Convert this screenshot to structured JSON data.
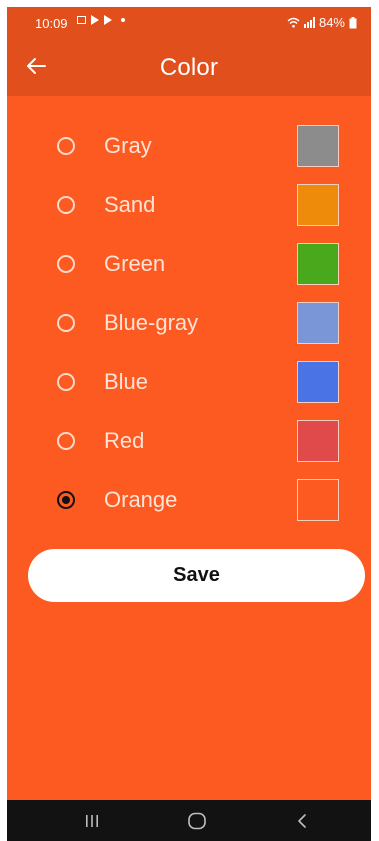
{
  "status_bar": {
    "time": "10:09",
    "battery": "84%",
    "icons": [
      "image-icon",
      "play-store-icon",
      "play-store-icon",
      "dot-icon",
      "wifi-icon",
      "signal-icon",
      "battery-icon"
    ]
  },
  "app_bar": {
    "title": "Color",
    "back_icon": "arrow-left-icon"
  },
  "options": [
    {
      "label": "Gray",
      "color": "#8c8c8c",
      "selected": false
    },
    {
      "label": "Sand",
      "color": "#ee8b0b",
      "selected": false
    },
    {
      "label": "Green",
      "color": "#4aa81d",
      "selected": false
    },
    {
      "label": "Blue-gray",
      "color": "#7a96d6",
      "selected": false
    },
    {
      "label": "Blue",
      "color": "#4a74e6",
      "selected": false
    },
    {
      "label": "Red",
      "color": "#e04a4a",
      "selected": false
    },
    {
      "label": "Orange",
      "color": "#fd5a22",
      "selected": true
    }
  ],
  "save_label": "Save",
  "nav_bar": {
    "icons": [
      "recent-apps-icon",
      "home-icon",
      "back-icon"
    ]
  },
  "colors": {
    "accent": "#fd5a22",
    "app_bar": "#e04f1c",
    "nav_bar": "#121212"
  }
}
